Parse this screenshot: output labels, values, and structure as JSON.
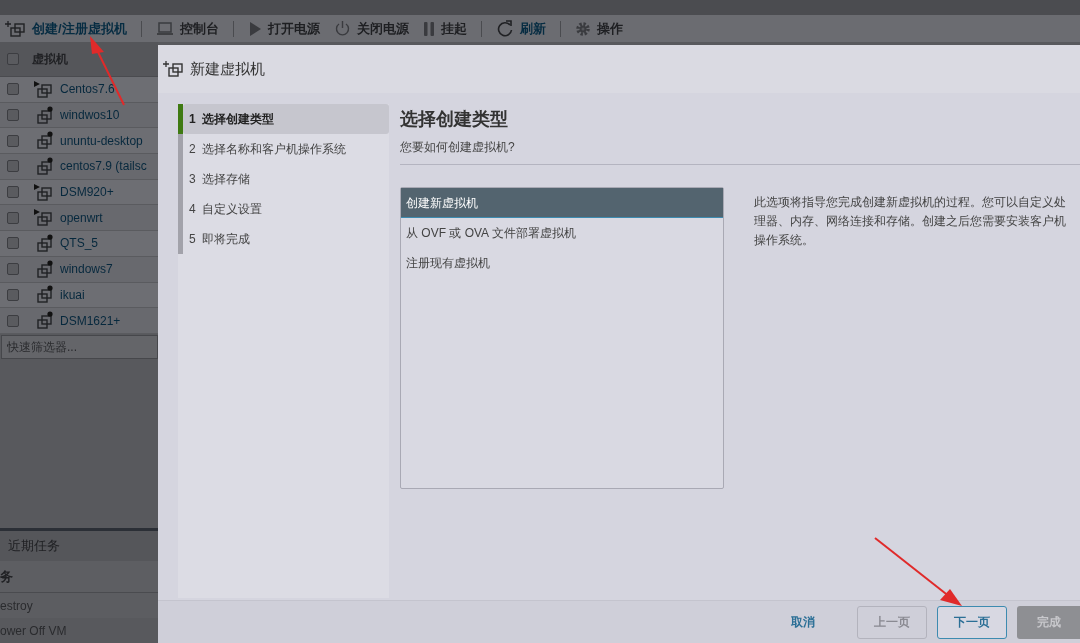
{
  "toolbar": {
    "items": [
      {
        "label": "创建/注册虚拟机",
        "kind": "add-vm",
        "disabled": false
      },
      {
        "label": "控制台",
        "kind": "console",
        "disabled": true
      },
      {
        "label": "打开电源",
        "kind": "play",
        "disabled": true
      },
      {
        "label": "关闭电源",
        "kind": "power",
        "disabled": true
      },
      {
        "label": "挂起",
        "kind": "pause",
        "disabled": true
      },
      {
        "label": "刷新",
        "kind": "refresh",
        "disabled": false
      },
      {
        "label": "操作",
        "kind": "gear",
        "disabled": true
      }
    ]
  },
  "vm_table": {
    "header": "虚拟机",
    "all_checked": false,
    "rows": [
      {
        "name": "Centos7.6",
        "checked": false,
        "has_children": true,
        "powered_on": false
      },
      {
        "name": "windwos10",
        "checked": false,
        "has_children": false,
        "powered_on": true
      },
      {
        "name": "ununtu-desktop",
        "checked": false,
        "has_children": false,
        "powered_on": true
      },
      {
        "name": "centos7.9 (tailsc",
        "checked": false,
        "has_children": false,
        "powered_on": true
      },
      {
        "name": "DSM920+",
        "checked": false,
        "has_children": true,
        "powered_on": false
      },
      {
        "name": "openwrt",
        "checked": false,
        "has_children": true,
        "powered_on": false
      },
      {
        "name": "QTS_5",
        "checked": false,
        "has_children": false,
        "powered_on": true
      },
      {
        "name": "windows7",
        "checked": false,
        "has_children": false,
        "powered_on": true
      },
      {
        "name": "ikuai",
        "checked": false,
        "has_children": false,
        "powered_on": true
      },
      {
        "name": "DSM1621+",
        "checked": false,
        "has_children": false,
        "powered_on": true
      }
    ]
  },
  "filter": {
    "placeholder": "快速筛选器..."
  },
  "recent_tasks": {
    "title": "近期任务",
    "column_1": "务",
    "rows": [
      "estroy",
      "ower Off VM"
    ]
  },
  "dialog": {
    "title": "新建虚拟机",
    "steps": [
      {
        "number": "1",
        "label": "选择创建类型",
        "selected": true
      },
      {
        "number": "2",
        "label": "选择名称和客户机操作系统",
        "selected": false
      },
      {
        "number": "3",
        "label": "选择存储",
        "selected": false
      },
      {
        "number": "4",
        "label": "自定义设置",
        "selected": false
      },
      {
        "number": "5",
        "label": "即将完成",
        "selected": false
      }
    ],
    "heading": "选择创建类型",
    "subheading": "您要如何创建虚拟机?",
    "options": [
      {
        "label": "创建新虚拟机",
        "selected": true
      },
      {
        "label": "从 OVF 或 OVA 文件部署虚拟机",
        "selected": false
      },
      {
        "label": "注册现有虚拟机",
        "selected": false
      }
    ],
    "description": "此选项将指导您完成创建新虚拟机的过程。您可以自定义处理器、内存、网络连接和存储。创建之后您需要安装客户机操作系统。",
    "buttons": [
      {
        "label": "取消",
        "kind": "link",
        "disabled": false
      },
      {
        "label": "上一页",
        "kind": "secondary",
        "disabled": true
      },
      {
        "label": "下一页",
        "kind": "secondary",
        "disabled": false
      },
      {
        "label": "完成",
        "kind": "primary",
        "disabled": true
      }
    ]
  }
}
